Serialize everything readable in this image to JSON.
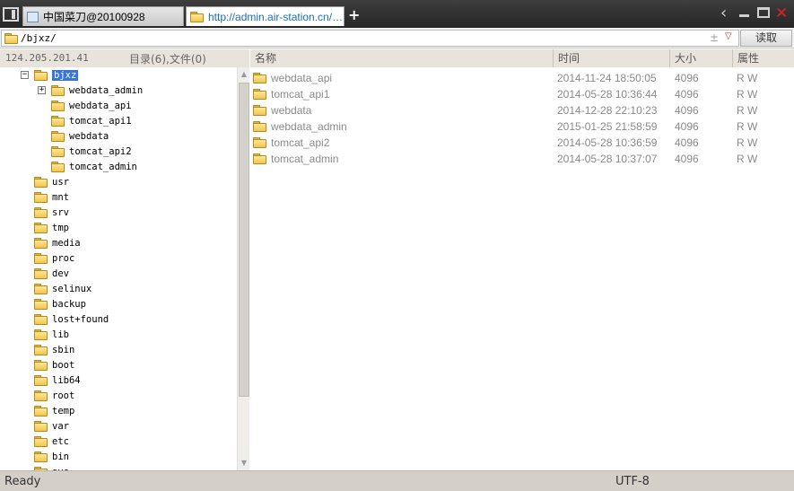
{
  "tabs": [
    {
      "label": "中国菜刀@20100928"
    },
    {
      "label": "http://admin.air-station.cn/dat..."
    }
  ],
  "new_tab_label": "+",
  "path": {
    "value": "/bjxz/",
    "star": "±",
    "dropdown": "▽",
    "read_button": "读取"
  },
  "left_header": {
    "host": "124.205.201.41",
    "counts": "目录(6),文件(0)"
  },
  "tree": {
    "root_selected": "bjxz",
    "root_toggle": "−",
    "children": [
      {
        "label": "webdata_admin",
        "toggle": "+"
      },
      {
        "label": "webdata_api"
      },
      {
        "label": "tomcat_api1"
      },
      {
        "label": "webdata"
      },
      {
        "label": "tomcat_api2"
      },
      {
        "label": "tomcat_admin"
      }
    ],
    "siblings": [
      "usr",
      "mnt",
      "srv",
      "tmp",
      "media",
      "proc",
      "dev",
      "selinux",
      "backup",
      "lost+found",
      "lib",
      "sbin",
      "boot",
      "lib64",
      "root",
      "temp",
      "var",
      "etc",
      "bin",
      "sys"
    ]
  },
  "columns": {
    "name": "名称",
    "time": "时间",
    "size": "大小",
    "attr": "属性"
  },
  "files": [
    {
      "name": "webdata_api",
      "time": "2014-11-24 18:50:05",
      "size": "4096",
      "attr": "R W"
    },
    {
      "name": "tomcat_api1",
      "time": "2014-05-28 10:36:44",
      "size": "4096",
      "attr": "R W"
    },
    {
      "name": "webdata",
      "time": "2014-12-28 22:10:23",
      "size": "4096",
      "attr": "R W"
    },
    {
      "name": "webdata_admin",
      "time": "2015-01-25 21:58:59",
      "size": "4096",
      "attr": "R W"
    },
    {
      "name": "tomcat_api2",
      "time": "2014-05-28 10:36:59",
      "size": "4096",
      "attr": "R W"
    },
    {
      "name": "tomcat_admin",
      "time": "2014-05-28 10:37:07",
      "size": "4096",
      "attr": "R W"
    }
  ],
  "status": {
    "text": "Ready",
    "encoding": "UTF-8"
  },
  "icons": {
    "folder": "folder-icon",
    "document": "document-icon",
    "back": "chevron-left-icon",
    "minimize": "minimize-icon",
    "maximize": "maximize-icon",
    "close": "close-icon"
  },
  "colors": {
    "selection": "#3875d7",
    "close": "#e32020",
    "active_tab_text": "#1a6fb8"
  }
}
